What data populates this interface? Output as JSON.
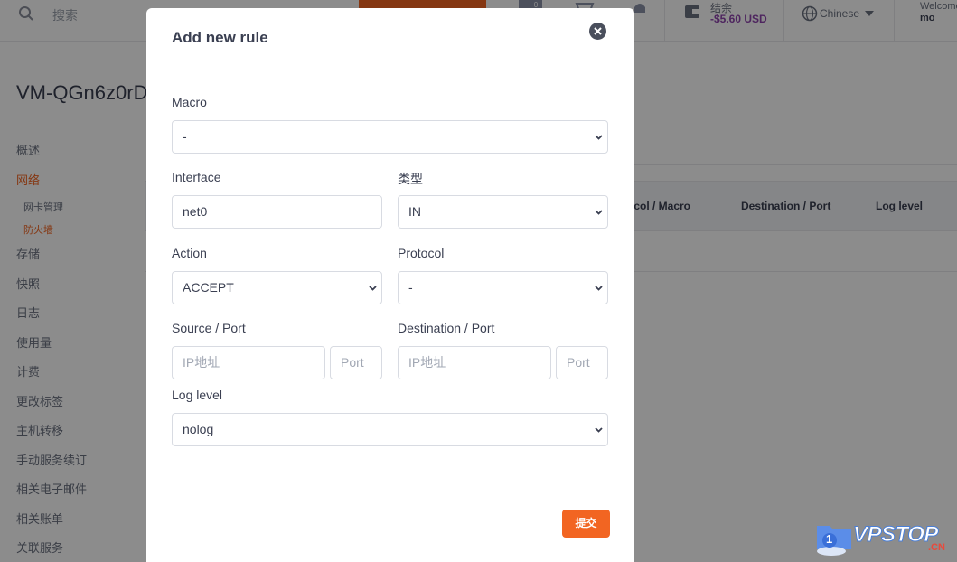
{
  "topbar": {
    "search_placeholder": "搜索",
    "cart_count": "0",
    "balance_label": "结余",
    "balance_value": "-$5.60 USD",
    "language": "Chinese",
    "welcome": "Welcome",
    "username": "mo"
  },
  "page": {
    "vm_title": "VM-QGn6z0rD"
  },
  "sidebar": {
    "items": [
      {
        "label": "概述"
      },
      {
        "label": "网络"
      },
      {
        "label": "存储"
      },
      {
        "label": "快照"
      },
      {
        "label": "日志"
      },
      {
        "label": "使用量"
      },
      {
        "label": "计费"
      },
      {
        "label": "更改标签"
      },
      {
        "label": "主机转移"
      },
      {
        "label": "手动服务续订"
      },
      {
        "label": "相关电子邮件"
      },
      {
        "label": "相关账单"
      },
      {
        "label": "关联服务"
      }
    ],
    "sub_items": [
      {
        "label": "网卡管理"
      },
      {
        "label": "防火墙"
      }
    ]
  },
  "table": {
    "headers": [
      "Protocol / Macro",
      "Destination / Port",
      "Log level"
    ],
    "visible_headers": [
      "tocol / Macro",
      "Destination / Port",
      "Log level"
    ]
  },
  "modal": {
    "title": "Add new rule",
    "macro_label": "Macro",
    "macro_value": "-",
    "interface_label": "Interface",
    "interface_value": "net0",
    "type_label": "类型",
    "type_value": "IN",
    "action_label": "Action",
    "action_value": "ACCEPT",
    "protocol_label": "Protocol",
    "protocol_value": "-",
    "source_label": "Source / Port",
    "source_ip_placeholder": "IP地址",
    "source_port_placeholder": "Port",
    "dest_label": "Destination / Port",
    "dest_ip_placeholder": "IP地址",
    "dest_port_placeholder": "Port",
    "log_label": "Log level",
    "log_value": "nolog",
    "submit_label": "提交"
  },
  "watermark": {
    "badge": "1",
    "text": "VPSTOP",
    "sub": ".CN"
  },
  "colors": {
    "accent": "#f26522",
    "balance": "#8e44ad",
    "text": "#3a3f51"
  }
}
